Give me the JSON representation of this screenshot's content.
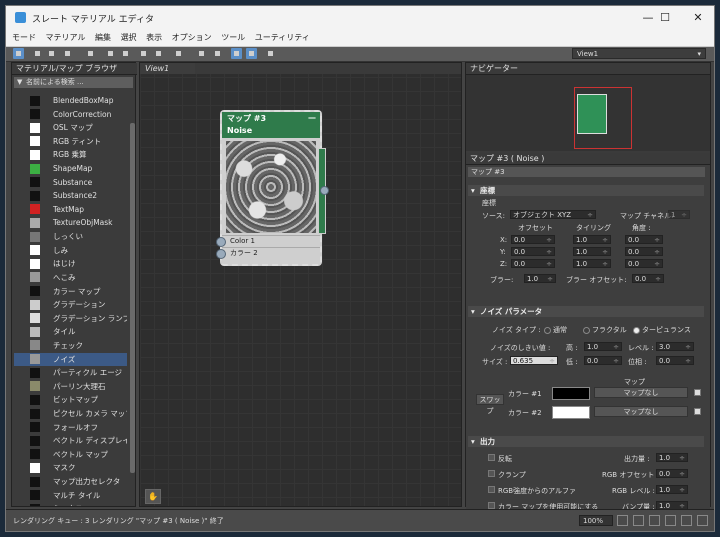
{
  "window": {
    "title": "スレート マテリアル エディタ",
    "min": "—",
    "max": "☐",
    "close": "✕"
  },
  "menu": [
    "モード",
    "マテリアル",
    "編集",
    "選択",
    "表示",
    "オプション",
    "ツール",
    "ユーティリティ"
  ],
  "toolbar": {
    "view_select": "View1"
  },
  "browser": {
    "title": "マテリアル/マップ ブラウザ",
    "search_placeholder": "名前による検索 ...",
    "items": [
      {
        "label": "BlendedBoxMap",
        "color": "#111111"
      },
      {
        "label": "ColorCorrection",
        "color": "#111111"
      },
      {
        "label": "OSL マップ",
        "color": "#ffffff"
      },
      {
        "label": "RGB ティント",
        "color": "#ffffff"
      },
      {
        "label": "RGB 乗算",
        "color": "#ffffff"
      },
      {
        "label": "ShapeMap",
        "color": "#3cb043"
      },
      {
        "label": "Substance",
        "color": "#111111"
      },
      {
        "label": "Substance2",
        "color": "#111111"
      },
      {
        "label": "TextMap",
        "color": "#d22222"
      },
      {
        "label": "TextureObjMask",
        "color": "#aaaaaa"
      },
      {
        "label": "しっくい",
        "color": "#777777"
      },
      {
        "label": "しみ",
        "color": "#ffffff"
      },
      {
        "label": "はじけ",
        "color": "#ffffff"
      },
      {
        "label": "へこみ",
        "color": "#999999"
      },
      {
        "label": "カラー マップ",
        "color": "#111111"
      },
      {
        "label": "グラデーション",
        "color": "#cccccc"
      },
      {
        "label": "グラデーション ランプ",
        "color": "#dddddd"
      },
      {
        "label": "タイル",
        "color": "#bbbbbb"
      },
      {
        "label": "チェック",
        "color": "#888888"
      },
      {
        "label": "ノイズ",
        "color": "#999999"
      },
      {
        "label": "パーティクル エージ",
        "color": "#111111"
      },
      {
        "label": "パーリン大理石",
        "color": "#8a8a6a"
      },
      {
        "label": "ビットマップ",
        "color": "#111111"
      },
      {
        "label": "ピクセル カメラ マップ",
        "color": "#111111"
      },
      {
        "label": "フォールオフ",
        "color": "#111111"
      },
      {
        "label": "ベクトル ディスプレイ...",
        "color": "#111111"
      },
      {
        "label": "ベクトル マップ",
        "color": "#111111"
      },
      {
        "label": "マスク",
        "color": "#ffffff"
      },
      {
        "label": "マップ出力セレクタ",
        "color": "#111111"
      },
      {
        "label": "マルチ タイル",
        "color": "#111111"
      },
      {
        "label": "ミックス",
        "color": "#111111"
      }
    ],
    "selected_index": 19
  },
  "view": {
    "tab": "View1",
    "node": {
      "title": "マップ #3",
      "subtitle": "Noise",
      "slot1": "Color 1",
      "slot2": "カラー 2"
    }
  },
  "navigator": {
    "title": "ナビゲーター"
  },
  "params": {
    "title": "マップ #3 ( Noise )",
    "name_value": "マップ #3",
    "coords": {
      "section": "座標",
      "group": "座標",
      "source_label": "ソース:",
      "source_value": "オブジェクト XYZ",
      "channel_label": "マップ チャネル:",
      "channel_value": "1",
      "offset_h": "オフセット",
      "tiling_h": "タイリング",
      "angle_h": "角度 :",
      "x_label": "X:",
      "y_label": "Y:",
      "z_label": "Z:",
      "offset": [
        "0.0",
        "0.0",
        "0.0"
      ],
      "tiling": [
        "1.0",
        "1.0",
        "1.0"
      ],
      "angle": [
        "0.0",
        "0.0",
        "0.0"
      ],
      "blur_label": "ブラー:",
      "blur_value": "1.0",
      "blur_offset_label": "ブラー オフセット:",
      "blur_offset_value": "0.0"
    },
    "noise": {
      "section": "ノイズ パラメータ",
      "type_label": "ノイズ タイプ :",
      "types": [
        "通常",
        "フラクタル",
        "ターピュランス"
      ],
      "selected_type": 2,
      "threshold_label": "ノイズのしきい値 :",
      "high_label": "高 :",
      "high_value": "1.0",
      "level_label": "レベル :",
      "level_value": "3.0",
      "low_label": "低 :",
      "low_value": "0.0",
      "size_label": "サイズ :",
      "size_value": "0.635",
      "phase_label": "位相 :",
      "phase_value": "0.0",
      "maps_label": "マップ",
      "swap_label": "スワップ",
      "color1_label": "カラー #1",
      "color1": "#000000",
      "color2_label": "カラー #2",
      "color2": "#ffffff",
      "no_map": "マップなし"
    },
    "output": {
      "section": "出力",
      "invert": "反転",
      "clamp": "クランプ",
      "alpha_rgb": "RGB強度からのアルファ",
      "enable_curve": "カラー マップを使用可能にする",
      "output_amount_label": "出力量 :",
      "output_amount": "1.0",
      "rgb_offset_label": "RGB オフセット :",
      "rgb_offset": "0.0",
      "rgb_level_label": "RGB レベル :",
      "rgb_level": "1.0",
      "bump_label": "バンプ量 :",
      "bump": "1.0"
    }
  },
  "status": {
    "text": "レンダリング キュー : 3  レンダリング \"マップ #3 ( Noise )\" 終了",
    "zoom": "100%"
  }
}
